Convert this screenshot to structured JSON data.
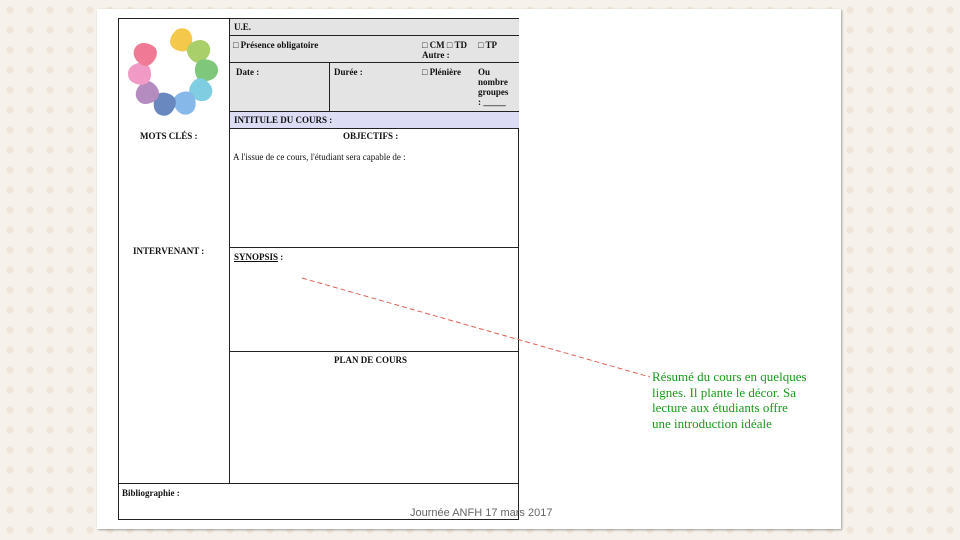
{
  "form": {
    "ue": "U.E.",
    "presence": "□  Présence obligatoire",
    "cm_td": "□ CM   □ TD",
    "tp": "□ TP",
    "autre": "Autre :",
    "date": "Date :",
    "duree": "Durée :",
    "pleniere": "□ Plénière",
    "groupes": [
      "Ou",
      "nombre",
      "groupes",
      ": _____"
    ],
    "intitule": "INTITULE DU COURS :",
    "mots_cles": "MOTS CLÉS :",
    "objectifs": "OBJECTIFS :",
    "objectifs_text": "A l'issue de ce cours, l'étudiant sera capable de :",
    "intervenant": "INTERVENANT :",
    "synopsis": "SYNOPSIS",
    "synopsis_colon": " :",
    "plan": "PLAN DE COURS",
    "bibliographie": "Bibliographie :"
  },
  "annotation": {
    "lines": [
      "Résumé du cours en quelques",
      "lignes. Il plante le décor. Sa",
      "lecture aux étudiants offre",
      "une introduction idéale"
    ],
    "color": "#1a9a1a"
  },
  "petal_colors": [
    "#f4c84a",
    "#a9cf6a",
    "#7fc77a",
    "#7fcde0",
    "#87b8ea",
    "#6a88c0",
    "#b48cc0",
    "#f19ac6",
    "#f07a96"
  ],
  "footer": "Journée ANFH 17 mars 2017"
}
